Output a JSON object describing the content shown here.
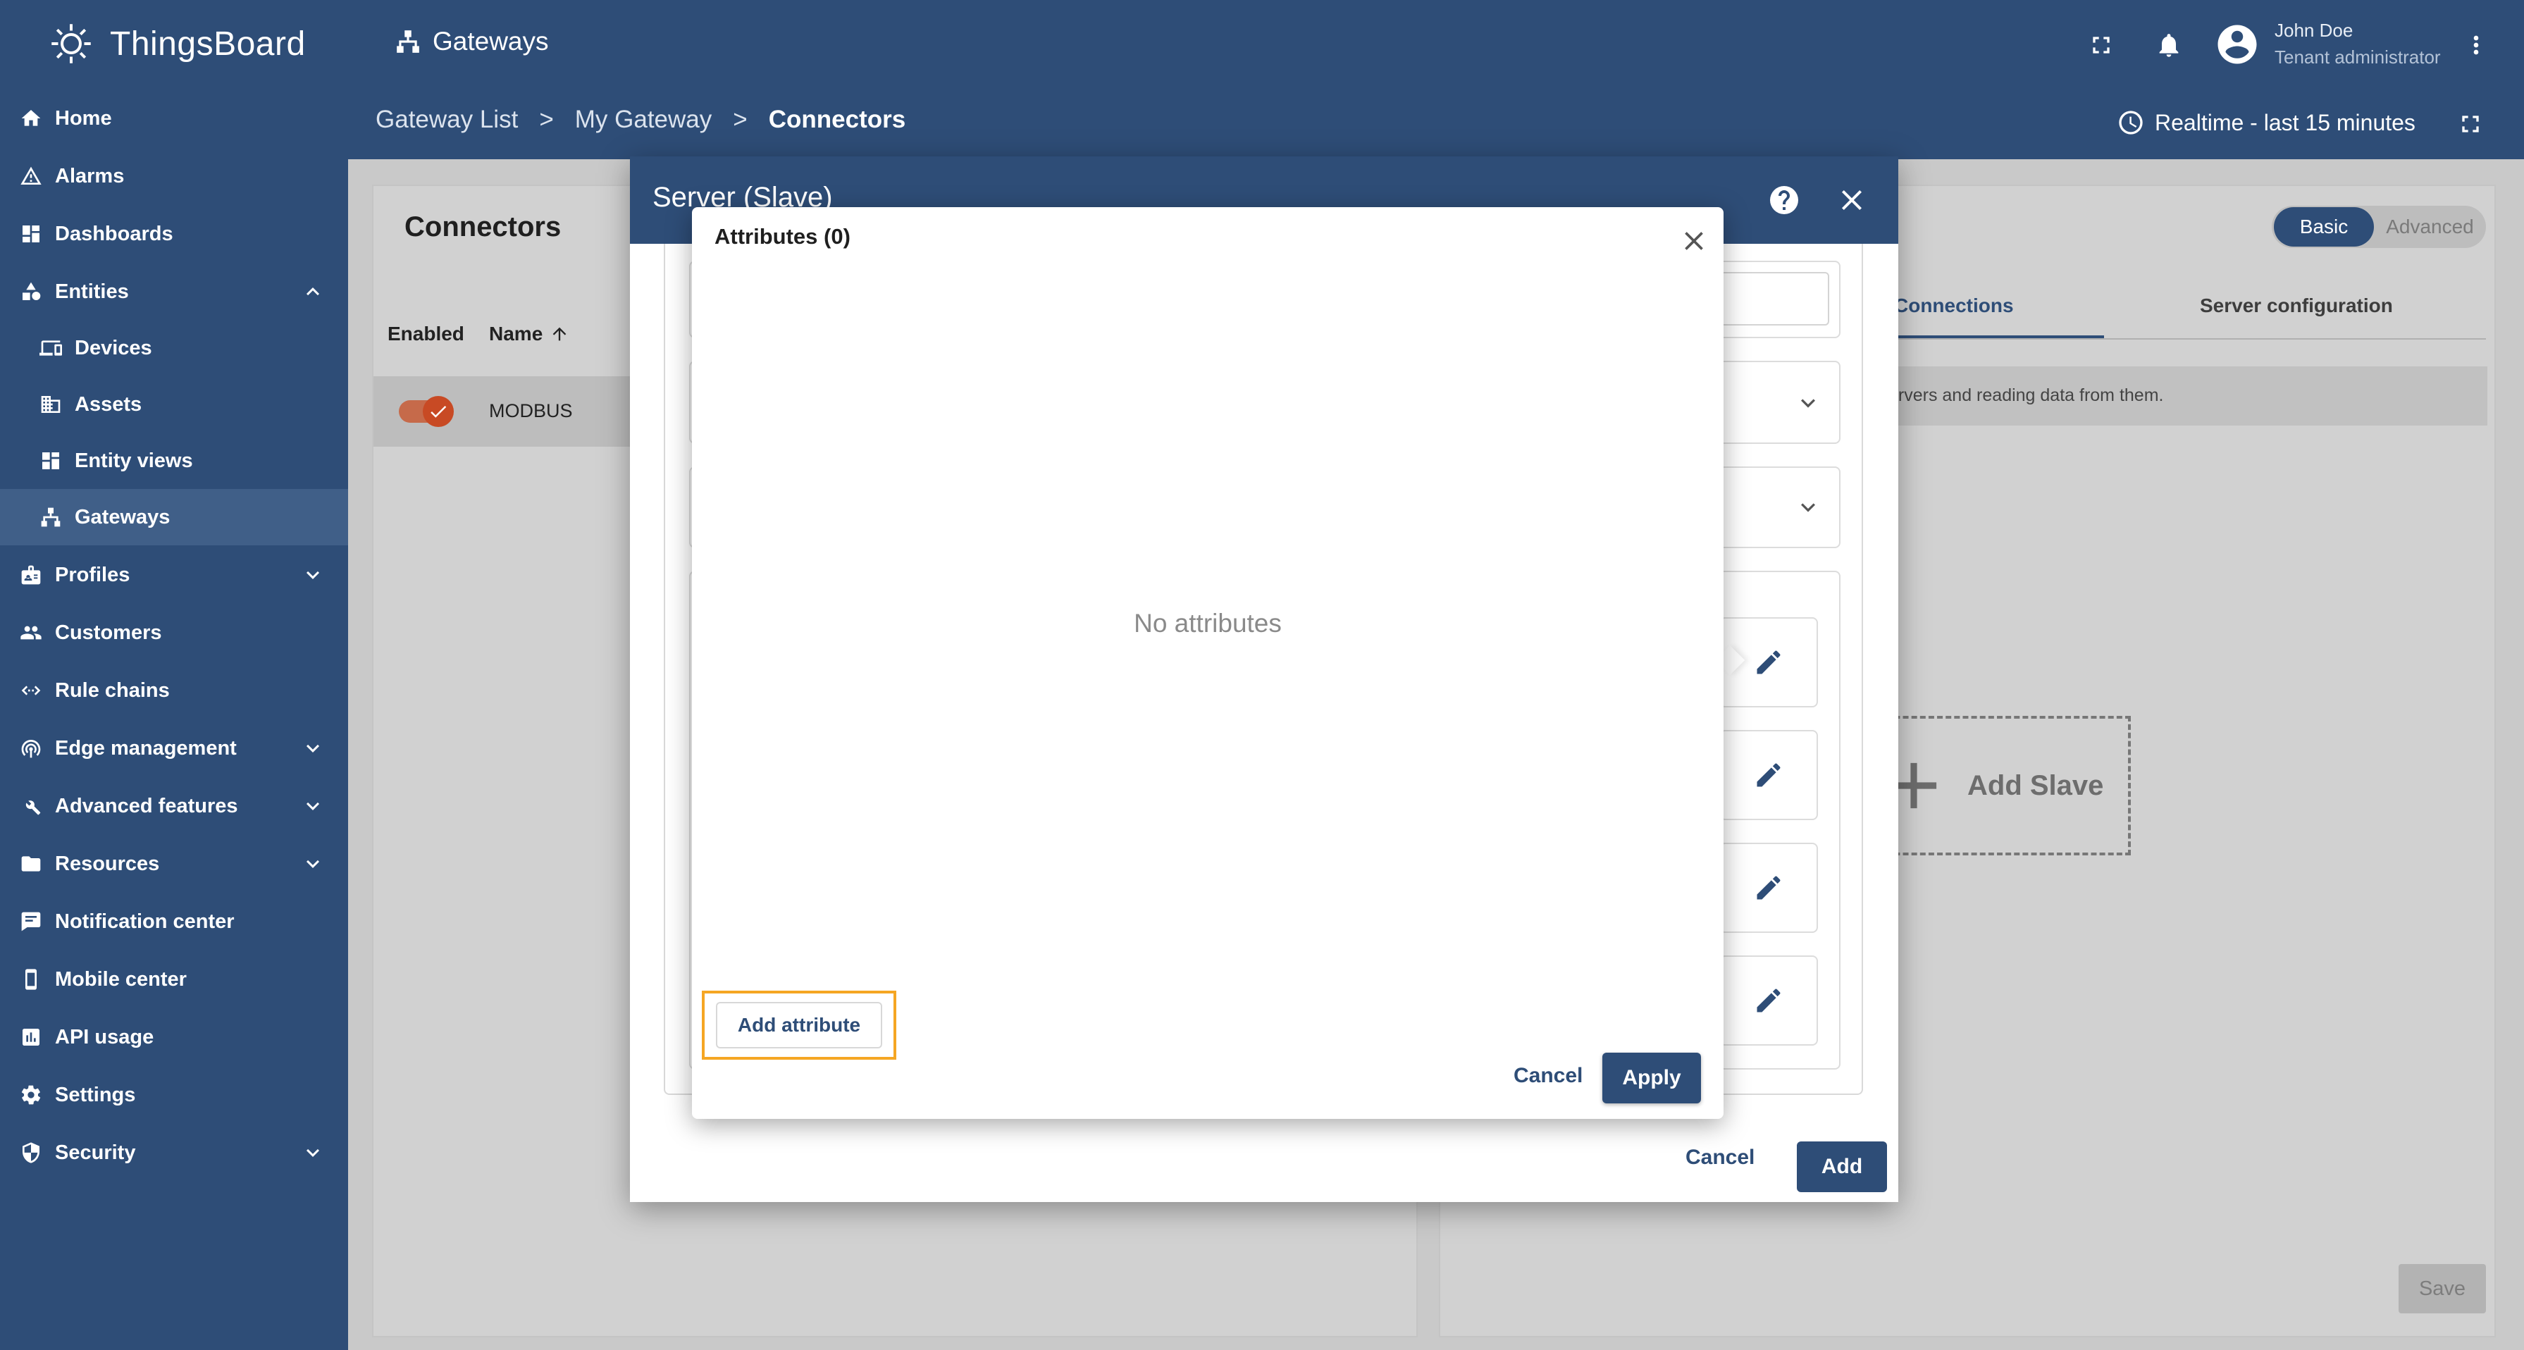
{
  "app": {
    "brand": "ThingsBoard"
  },
  "sidebar": {
    "items": [
      {
        "label": "Home",
        "icon": "home-icon"
      },
      {
        "label": "Alarms",
        "icon": "warning-icon"
      },
      {
        "label": "Dashboards",
        "icon": "dashboard-icon"
      },
      {
        "label": "Entities",
        "icon": "entities-icon",
        "expanded": true
      },
      {
        "label": "Devices",
        "icon": "devices-icon"
      },
      {
        "label": "Assets",
        "icon": "assets-icon"
      },
      {
        "label": "Entity views",
        "icon": "entity-views-icon"
      },
      {
        "label": "Gateways",
        "icon": "gateways-icon",
        "active": true
      },
      {
        "label": "Profiles",
        "icon": "profiles-icon"
      },
      {
        "label": "Customers",
        "icon": "customers-icon"
      },
      {
        "label": "Rule chains",
        "icon": "rule-chains-icon"
      },
      {
        "label": "Edge management",
        "icon": "edge-icon"
      },
      {
        "label": "Advanced features",
        "icon": "tools-icon"
      },
      {
        "label": "Resources",
        "icon": "folder-icon"
      },
      {
        "label": "Notification center",
        "icon": "notification-icon"
      },
      {
        "label": "Mobile center",
        "icon": "mobile-icon"
      },
      {
        "label": "API usage",
        "icon": "api-usage-icon"
      },
      {
        "label": "Settings",
        "icon": "gear-icon"
      },
      {
        "label": "Security",
        "icon": "shield-icon"
      }
    ]
  },
  "header": {
    "title": "Gateways",
    "breadcrumb": {
      "first": "Gateway List",
      "sep": ">",
      "second": "My Gateway",
      "current": "Connectors"
    },
    "user": {
      "name": "John Doe",
      "role": "Tenant administrator"
    },
    "timewindow": "Realtime - last 15 minutes"
  },
  "connectors": {
    "title": "Connectors",
    "columns": {
      "enabled": "Enabled",
      "name": "Name"
    },
    "rows": [
      {
        "name": "MODBUS",
        "enabled": true
      }
    ]
  },
  "config": {
    "modes": {
      "basic": "Basic",
      "advanced": "Advanced"
    },
    "tabs": {
      "connections": "Connections",
      "server": "Server configuration"
    },
    "info": "ervers and reading data from them.",
    "add_slave": "Add Slave",
    "save": "Save"
  },
  "dialog": {
    "title": "Server (Slave)",
    "cancel": "Cancel",
    "add": "Add"
  },
  "attributes_popover": {
    "title": "Attributes (0)",
    "empty": "No attributes",
    "add_attribute": "Add attribute",
    "cancel": "Cancel",
    "apply": "Apply"
  },
  "colors": {
    "primary": "#2e4d77",
    "highlight": "#f5a623",
    "toggle": "#c84a24"
  }
}
